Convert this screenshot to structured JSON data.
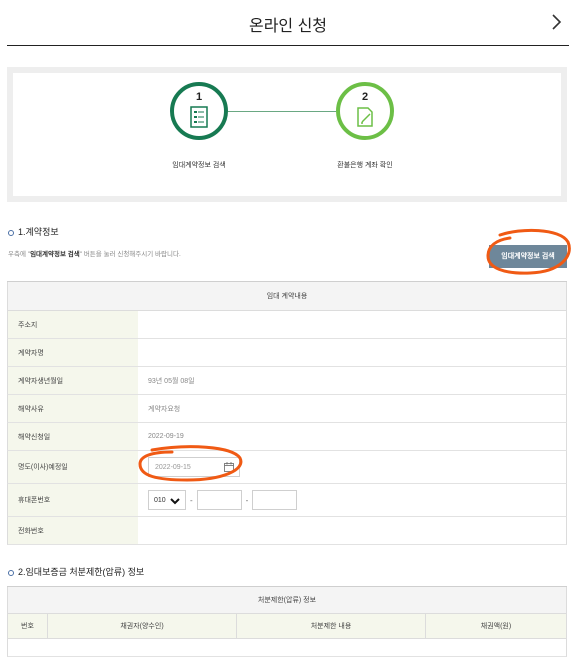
{
  "header": {
    "title": "온라인 신청",
    "next_icon": "chevron-right-icon"
  },
  "steps": [
    {
      "number": "1",
      "label": "임대계약정보 검색",
      "icon": "document-list-icon",
      "color": "#177a52"
    },
    {
      "number": "2",
      "label": "환불은행 계좌 확인",
      "icon": "edit-document-icon",
      "color": "#6cbf46"
    }
  ],
  "contract_section": {
    "title": "1.계약정보",
    "notice_pre": "우측에 \"",
    "notice_bold": "임대계약정보 검색",
    "notice_post": "\" 버튼을 눌러 신청해주시기 바랍니다.",
    "search_button": "임대계약정보 검색",
    "table_header": "임대 계약내용",
    "rows": [
      {
        "label": "주소지",
        "value": ""
      },
      {
        "label": "계약자명",
        "value": ""
      },
      {
        "label": "계약자생년월일",
        "value": "93년 05월 08일"
      },
      {
        "label": "해약사유",
        "value": "계약자요청"
      },
      {
        "label": "해약신청일",
        "value": "2022-09-19"
      }
    ],
    "move_out": {
      "label": "명도(이사)예정일",
      "value": "2022-09-15"
    },
    "phone": {
      "label": "휴대폰번호",
      "prefix": "010",
      "dash": "-"
    },
    "tel": {
      "label": "전화번호",
      "value": ""
    }
  },
  "garnish_section": {
    "title": "2.임대보증금 처분제한(압류) 정보",
    "table_header": "처분제한(압류) 정보",
    "columns": [
      "번호",
      "채권자(양수인)",
      "처분제한 내용",
      "채권액(원)"
    ]
  },
  "colors": {
    "accent_orange": "#f05a14",
    "button_bg": "#6e879a",
    "label_bg": "#f5f7ec"
  }
}
